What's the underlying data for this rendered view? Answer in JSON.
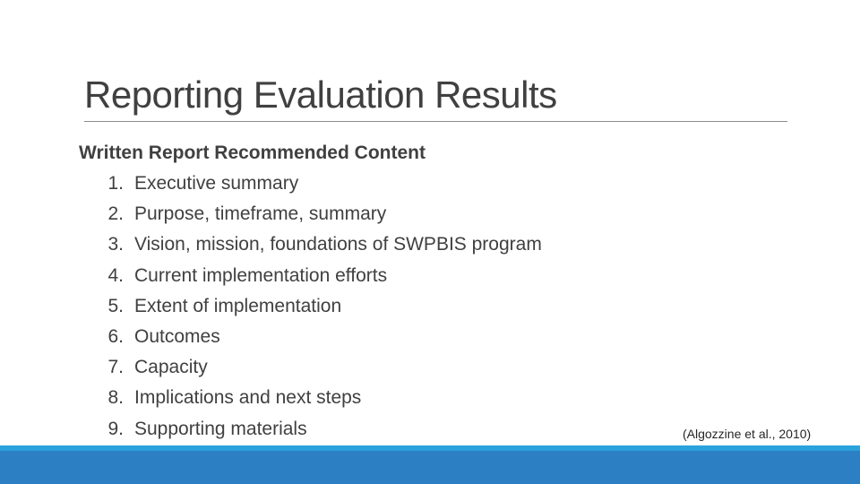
{
  "slide": {
    "title": "Reporting Evaluation Results",
    "heading": "Written Report Recommended Content",
    "items": [
      {
        "num": "1.",
        "text": "Executive summary"
      },
      {
        "num": "2.",
        "text": "Purpose, timeframe, summary"
      },
      {
        "num": "3.",
        "text": "Vision, mission, foundations of SWPBIS program"
      },
      {
        "num": "4.",
        "text": "Current implementation efforts"
      },
      {
        "num": "5.",
        "text": "Extent of implementation"
      },
      {
        "num": "6.",
        "text": "Outcomes"
      },
      {
        "num": "7.",
        "text": "Capacity"
      },
      {
        "num": "8.",
        "text": "Implications and next steps"
      },
      {
        "num": "9.",
        "text": "Supporting materials"
      }
    ],
    "citation": "(Algozzine et al., 2010)"
  },
  "colors": {
    "footer_bar": "#2b7fc2",
    "footer_strip": "#2aa2dc",
    "title_rule": "#8c8c8c",
    "text": "#404040"
  }
}
